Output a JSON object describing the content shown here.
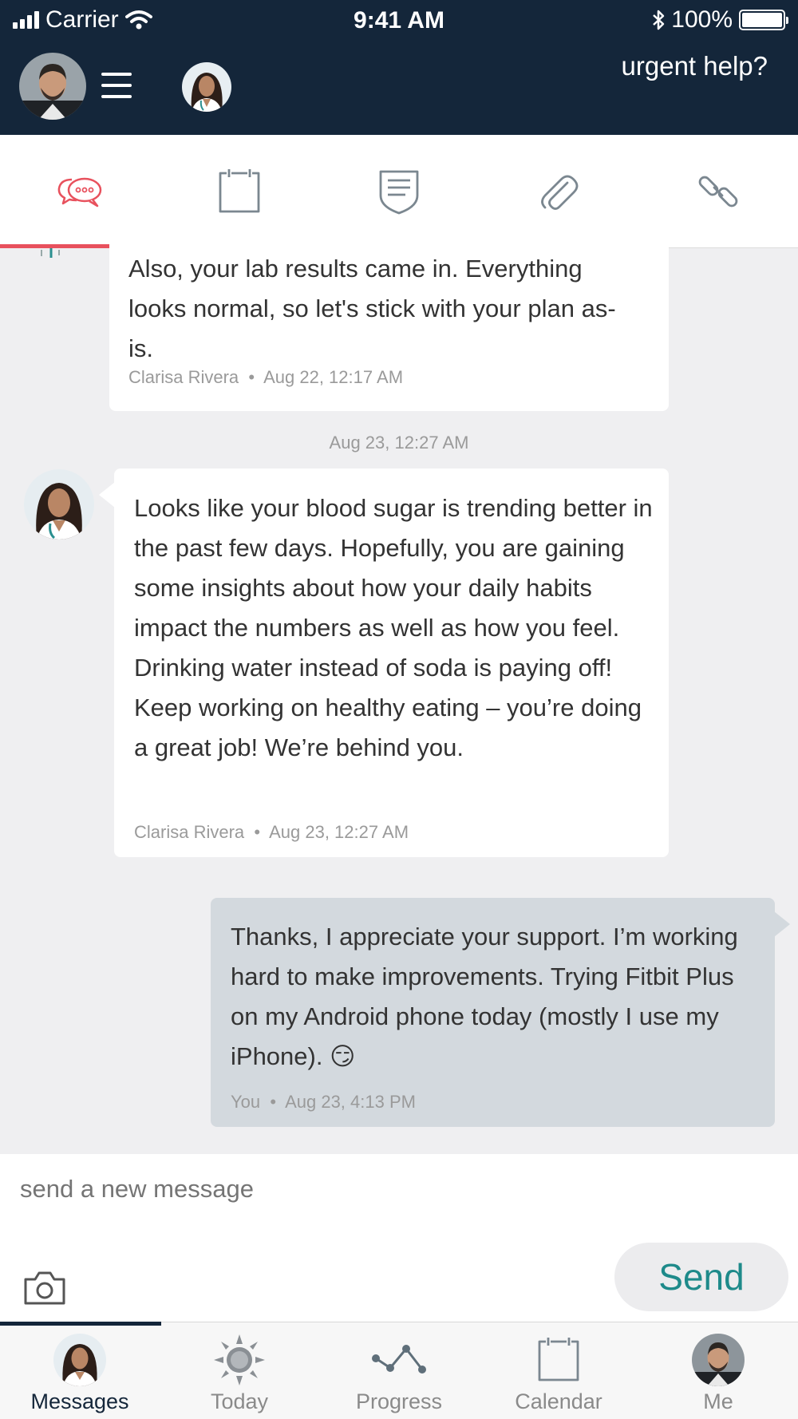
{
  "status_bar": {
    "carrier": "Carrier",
    "time": "9:41 AM",
    "battery": "100%",
    "battery_level": 1.0
  },
  "header": {
    "urgent_help": "urgent help?"
  },
  "tabs": [
    {
      "name": "messages",
      "icon": "chat-bubbles-icon",
      "active": true
    },
    {
      "name": "calendar",
      "icon": "clipboard-icon",
      "active": false
    },
    {
      "name": "notes",
      "icon": "shield-notes-icon",
      "active": false
    },
    {
      "name": "attachments",
      "icon": "paperclip-icon",
      "active": false
    },
    {
      "name": "links",
      "icon": "link-icon",
      "active": false
    }
  ],
  "messages": [
    {
      "text": "Also, your lab results came in. Everything looks normal, so let's stick with your plan as-is.",
      "author": "Clarisa Rivera",
      "time": "Aug 22, 12:17 AM"
    },
    {
      "date_separator": "Aug 23, 12:27 AM",
      "text": "Looks like your blood sugar is trending better in the past few days. Hopefully, you are gaining some insights about how your daily habits impact the numbers as well as how you feel. Drinking water instead of soda is paying off! Keep working on healthy eating – you’re doing a great job! We’re behind you.",
      "author": "Clarisa Rivera",
      "time": "Aug 23, 12:27 AM"
    },
    {
      "text": "Thanks, I appreciate your support. I’m working hard to make improvements. Trying Fitbit Plus on my Android phone today (mostly I use my iPhone).",
      "emoji": "😏",
      "author": "You",
      "time": "Aug 23, 4:13 PM"
    }
  ],
  "compose": {
    "placeholder": "send a new message",
    "send_label": "Send"
  },
  "bottom_nav": [
    {
      "label": "Messages",
      "active": true
    },
    {
      "label": "Today",
      "active": false
    },
    {
      "label": "Progress",
      "active": false
    },
    {
      "label": "Calendar",
      "active": false
    },
    {
      "label": "Me",
      "active": false
    }
  ],
  "colors": {
    "header": "#14263a",
    "accent": "#e8515d",
    "send": "#1e8a8a",
    "outgoing_bubble": "#d3d9de",
    "background": "#efeff1"
  }
}
